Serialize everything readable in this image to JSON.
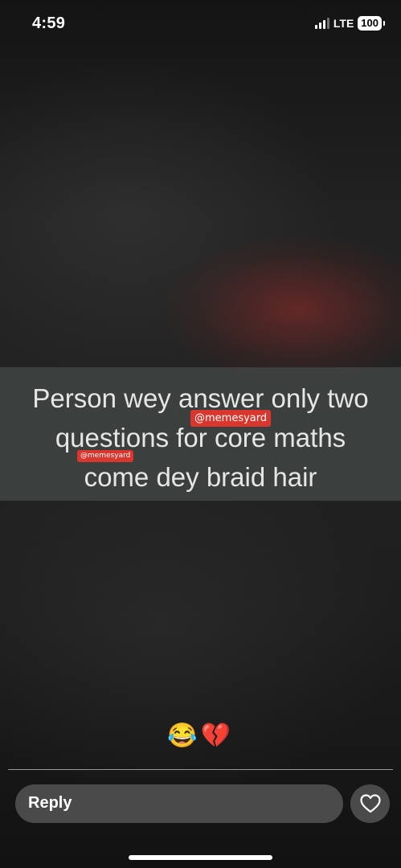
{
  "status_bar": {
    "time": "4:59",
    "network": "LTE",
    "battery": "100",
    "icons": [
      "cellular-signal-icon",
      "battery-icon"
    ]
  },
  "story": {
    "caption_lines": [
      "Person wey answer only two",
      "questions for core maths",
      "come dey braid hair"
    ],
    "watermarks": [
      "@memesyard",
      "@memesyard"
    ],
    "reactions": "😂💔",
    "background_tint": "#5a2a28"
  },
  "reply": {
    "label": "Reply",
    "icons": [
      "heart-icon"
    ]
  }
}
